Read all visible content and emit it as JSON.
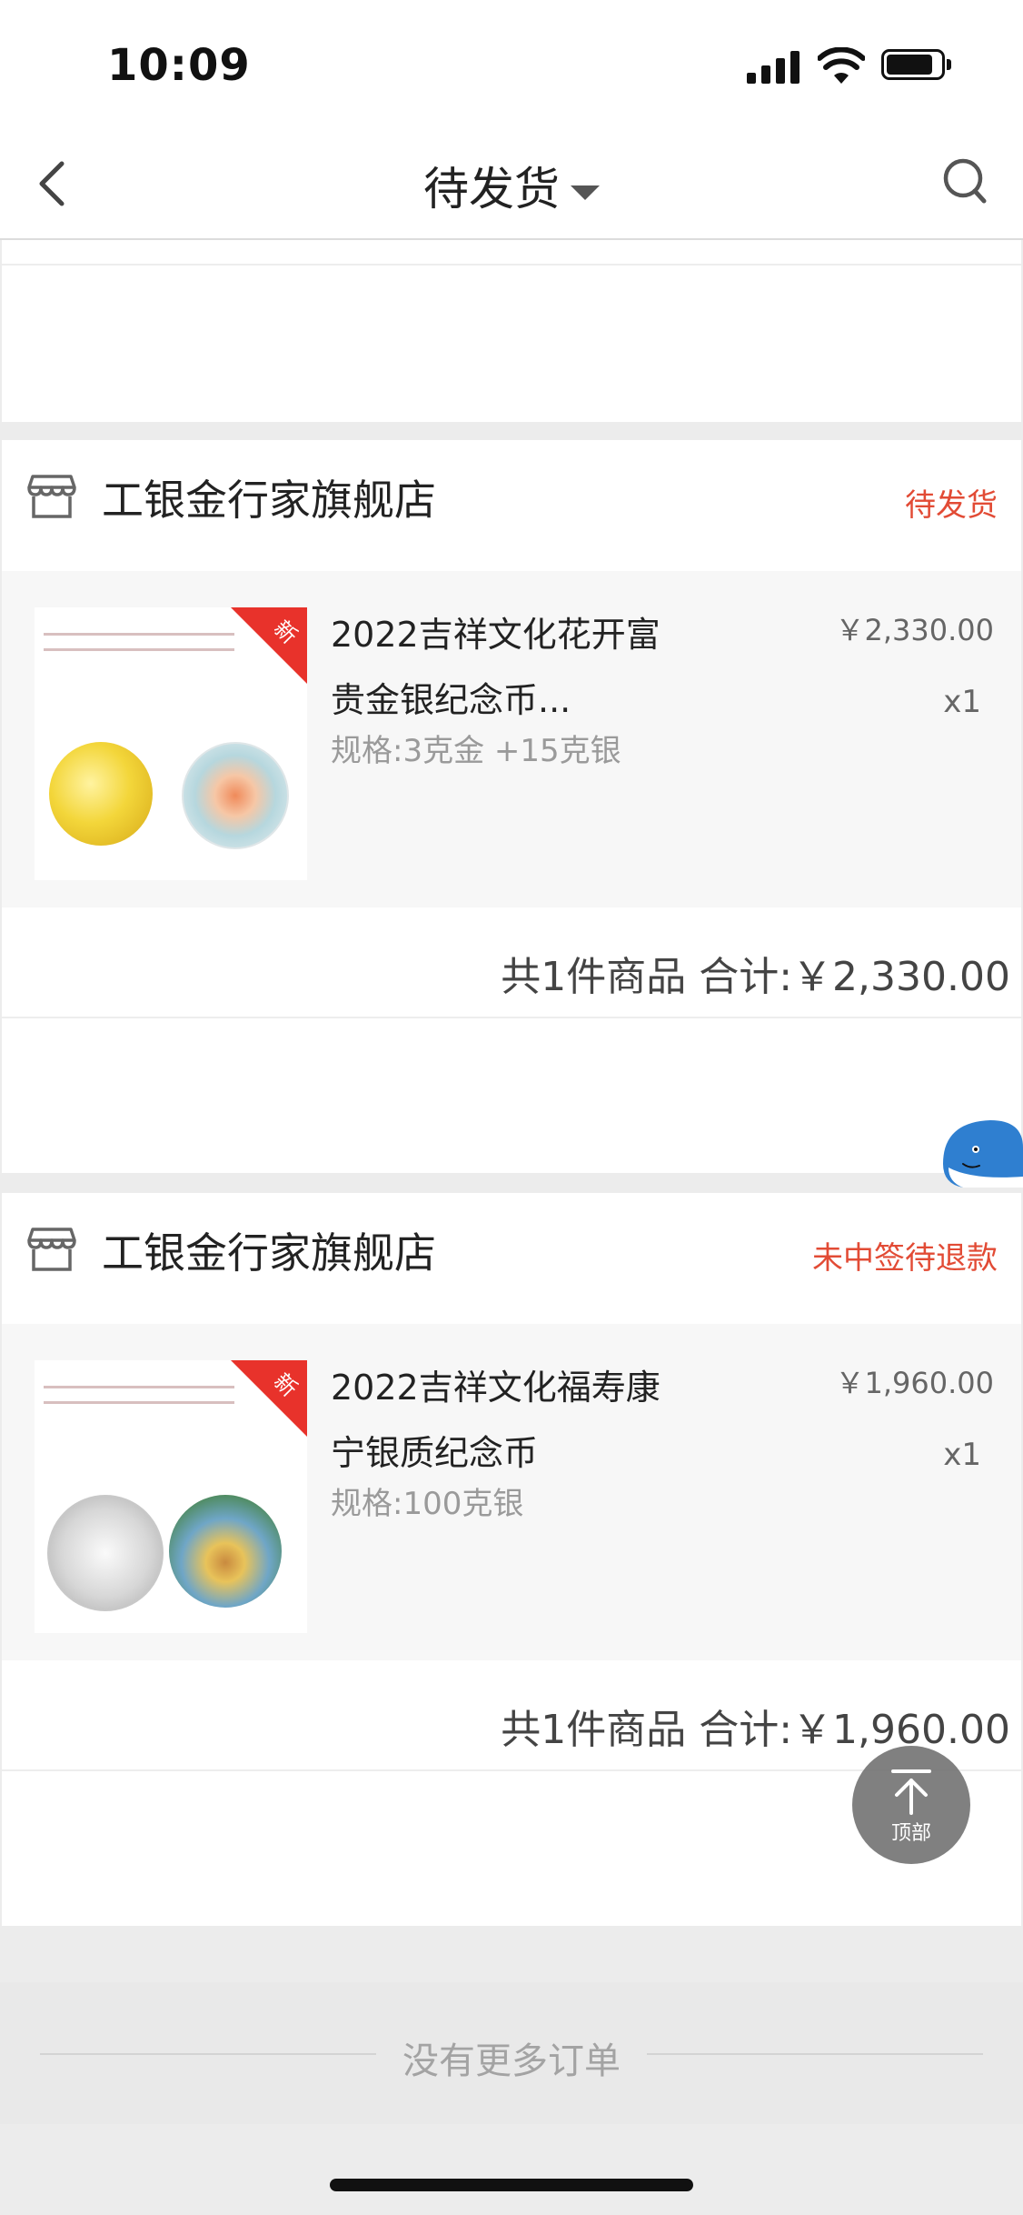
{
  "status_bar": {
    "time": "10:09"
  },
  "nav": {
    "title": "待发货"
  },
  "orders": [
    {
      "store": "工银金行家旗舰店",
      "status": "待发货",
      "item": {
        "badge": "新",
        "title": "2022吉祥文化花开富贵金银纪念币...",
        "spec": "规格:3克金 +15克银",
        "price": "￥2,330.00",
        "qty": "x1"
      },
      "total": "共1件商品 合计:￥2,330.00"
    },
    {
      "store": "工银金行家旗舰店",
      "status": "未中签待退款",
      "item": {
        "badge": "新",
        "title": "2022吉祥文化福寿康宁银质纪念币",
        "spec": "规格:100克银",
        "price": "￥1,960.00",
        "qty": "x1"
      },
      "total": "共1件商品 合计:￥1,960.00"
    }
  ],
  "footer": {
    "no_more": "没有更多订单"
  },
  "back_to_top": {
    "label": "顶部"
  },
  "colors": {
    "accent_red": "#e24b35",
    "badge_red": "#e8322b",
    "gold": "#e7c22a"
  }
}
